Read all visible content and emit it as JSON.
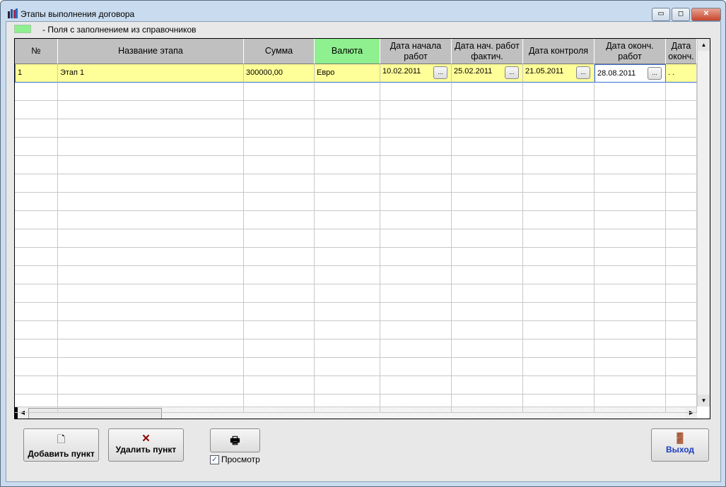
{
  "window": {
    "title": "Этапы выполнения договора",
    "minimize": "▭",
    "restore": "◻",
    "close": "✕"
  },
  "legend": {
    "text": "-  Поля с заполнением из справочников",
    "color": "#8ef08e"
  },
  "table": {
    "columns": [
      "№",
      "Название этапа",
      "Сумма",
      "Валюта",
      "Дата начала работ",
      "Дата нач. работ фактич.",
      "Дата контроля",
      "Дата оконч. работ",
      "Дата оконч."
    ],
    "rows": [
      [
        "1",
        "Этап 1",
        "300000,00",
        "Евро",
        "10.02.2011",
        "25.02.2011",
        "21.05.2011",
        "28.08.2011",
        ". ."
      ]
    ],
    "date_button": "..."
  },
  "buttons": {
    "add": "Добавить пункт",
    "delete": "Удалить пункт",
    "exit": "Выход",
    "preview": "Просмотр"
  }
}
